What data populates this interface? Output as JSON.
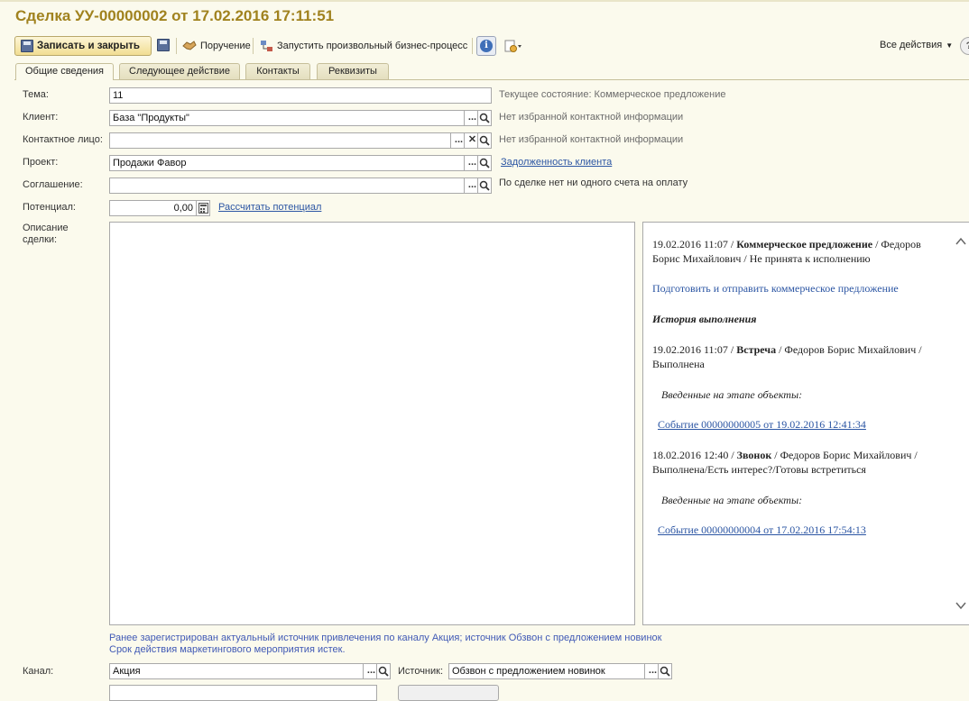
{
  "window": {
    "title": "Сделка УУ-00000002 от 17.02.2016 17:11:51"
  },
  "toolbar": {
    "save_close": "Записать и закрыть",
    "assignment": "Поручение",
    "bp": "Запустить произвольный бизнес-процесс",
    "all_actions": "Все действия",
    "help": "?"
  },
  "tabs": [
    "Общие сведения",
    "Следующее действие",
    "Контакты",
    "Реквизиты"
  ],
  "form": {
    "topic_label": "Тема:",
    "topic_value": "11",
    "client_label": "Клиент:",
    "client_value": "База \"Продукты\"",
    "contact_label": "Контактное лицо:",
    "contact_value": "",
    "project_label": "Проект:",
    "project_value": "Продажи Фавор",
    "agreement_label": "Соглашение:",
    "agreement_value": "",
    "potential_label": "Потенциал:",
    "potential_value": "0,00",
    "description_label": "Описание сделки:",
    "channel_label": "Канал:",
    "channel_value": "Акция",
    "source_label": "Источник:",
    "source_value": "Обзвон с предложением новинок"
  },
  "side": {
    "state": "Текущее состояние: Коммерческое предложение",
    "client_contact": "Нет избранной контактной информации",
    "person_contact": "Нет избранной контактной информации",
    "debt_link": "Задолженность клиента",
    "no_invoice": "По сделке нет ни одного счета на оплату",
    "calc_potential": "Рассчитать потенциал"
  },
  "history": {
    "item1_date": "19.02.2016 11:07 /",
    "item1_stage": "Коммерческое предложение",
    "item1_rest": "/ Федоров Борис Михайлович / Не принята к исполнению",
    "action_link": "Подготовить и отправить коммерческое предложение",
    "history_title": "История выполнения",
    "item2_date": "19.02.2016 11:07 /",
    "item2_stage": "Встреча",
    "item2_rest": "/ Федоров Борис Михайлович / Выполнена",
    "objects_label_1": "Введенные на этапе объекты:",
    "event_link_1": "Событие 00000000005 от 19.02.2016 12:41:34",
    "item3_date": "18.02.2016 12:40 /",
    "item3_stage": "Звонок",
    "item3_rest": "/ Федоров Борис Михайлович / Выполнена/Есть интерес?/Готовы встретиться",
    "objects_label_2": "Введенные на этапе объекты:",
    "event_link_2": "Событие 00000000004 от 17.02.2016 17:54:13"
  },
  "messages": {
    "line1": "Ранее зарегистрирован актуальный источник привлечения по каналу Акция; источник Обзвон с предложением новинок",
    "line2": "Срок действия маркетингового мероприятия истек."
  },
  "colors": {
    "title": "#a0821e",
    "link": "#2b55a3",
    "background": "#fbfaed"
  }
}
